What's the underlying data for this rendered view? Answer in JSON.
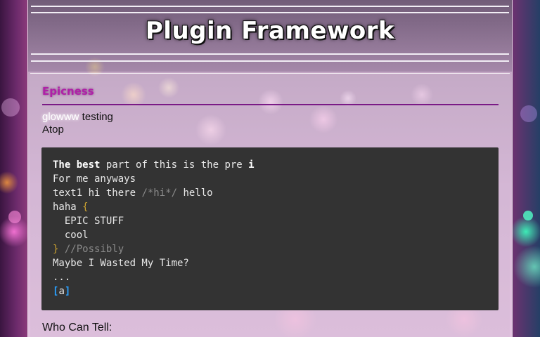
{
  "header": {
    "title": "Plugin Framework"
  },
  "section": {
    "title": "Epicness"
  },
  "intro": {
    "glow_word": "glowww",
    "rest": " testing",
    "line2": "Atop"
  },
  "code": {
    "line1": {
      "bold": "The best",
      "rest": " part of this is the pre ",
      "info": "i"
    },
    "line2": "For me anyways",
    "line3": {
      "text": "text1 hi there ",
      "comment": "/*hi*/",
      "after": " hello"
    },
    "line4": {
      "text": "haha ",
      "brace": "{"
    },
    "line5": "  EPIC STUFF",
    "line6": "  cool",
    "line7": {
      "brace": "}",
      "comment": " //Possibly"
    },
    "line8": "Maybe I Wasted My Time?",
    "line9": "...",
    "line10": {
      "open": "[",
      "text": "a",
      "close": "]"
    }
  },
  "footer": {
    "text": "Who Can Tell:"
  }
}
